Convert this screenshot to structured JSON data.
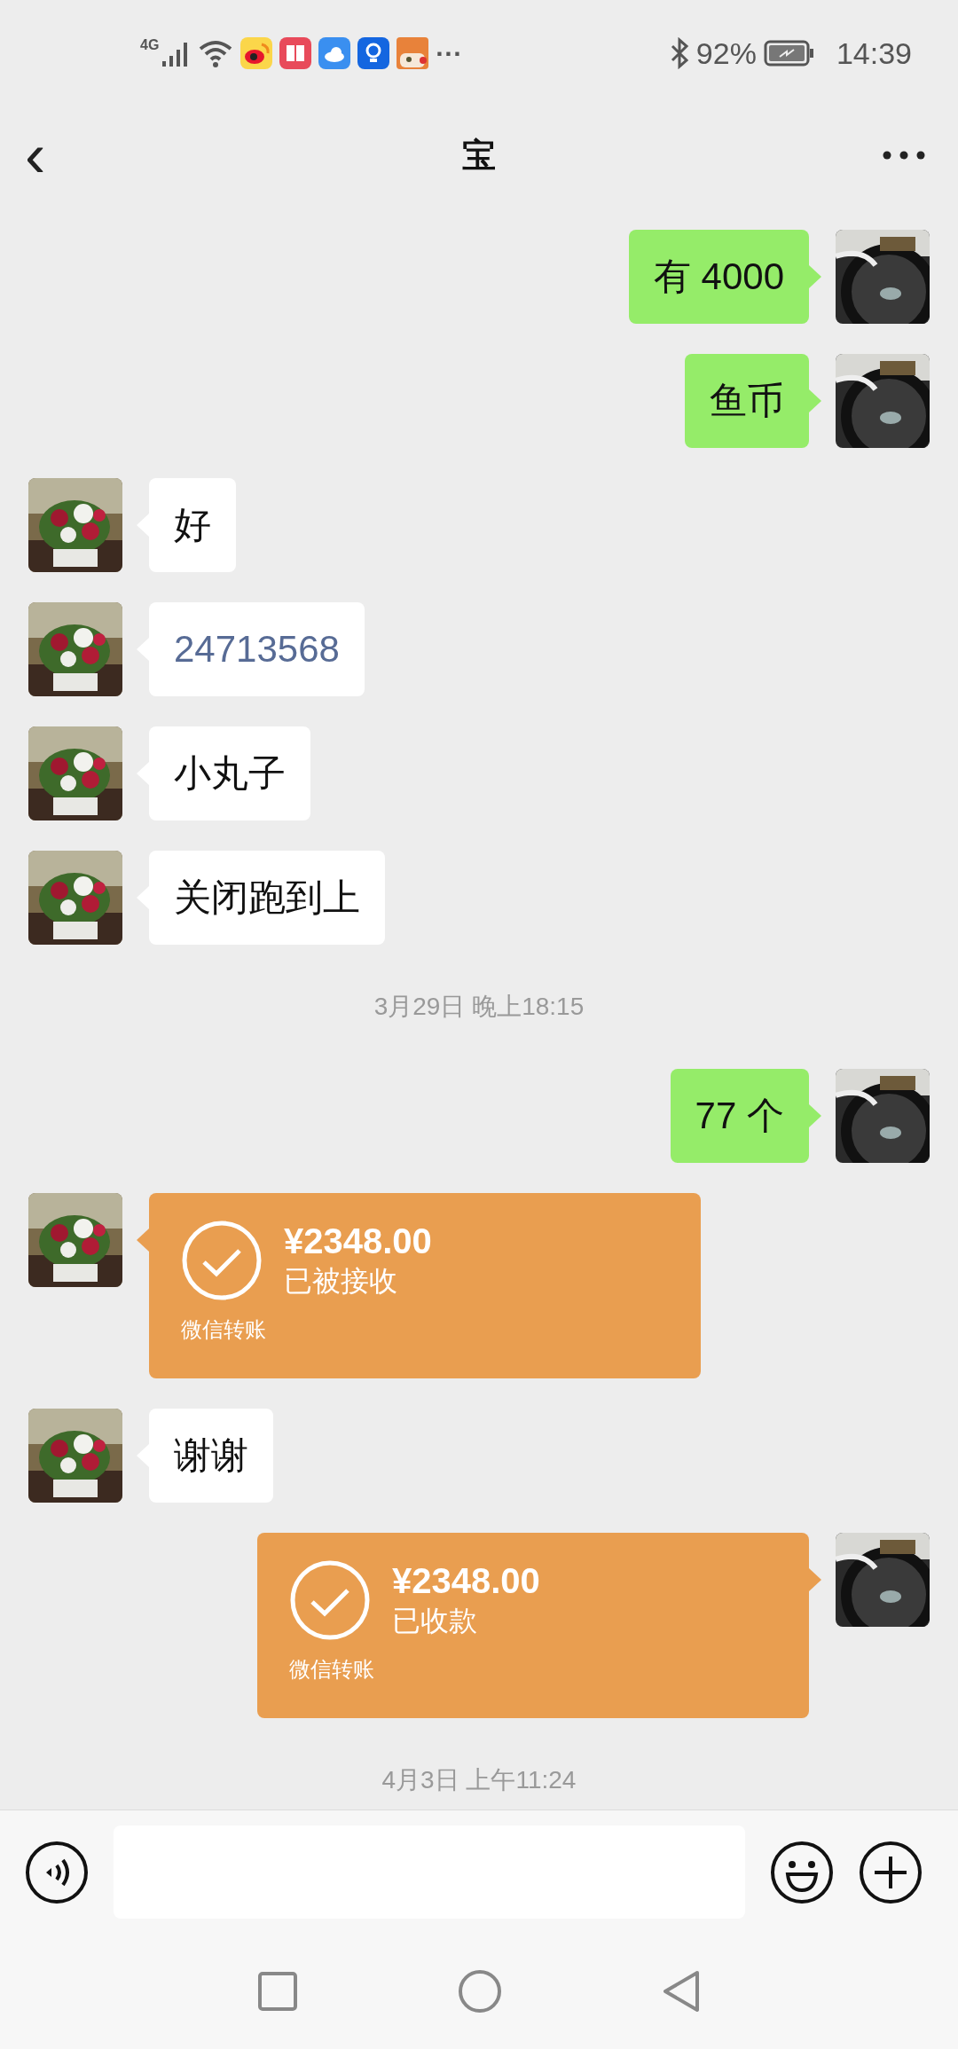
{
  "status_bar": {
    "network": "4G",
    "more": "···",
    "battery": "92%",
    "time": "14:39"
  },
  "header": {
    "back": "‹",
    "title": "宝"
  },
  "messages": [
    {
      "kind": "text",
      "outgoing": true,
      "text": "有 4000"
    },
    {
      "kind": "text",
      "outgoing": true,
      "text": "鱼币"
    },
    {
      "kind": "text",
      "outgoing": false,
      "text": "好"
    },
    {
      "kind": "number",
      "outgoing": false,
      "text": "24713568"
    },
    {
      "kind": "text",
      "outgoing": false,
      "text": "小丸子"
    },
    {
      "kind": "text",
      "outgoing": false,
      "text": "关闭跑到上"
    },
    {
      "kind": "time",
      "text": "3月29日 晚上18:15"
    },
    {
      "kind": "text",
      "outgoing": true,
      "text": "77 个"
    },
    {
      "kind": "transfer",
      "outgoing": false,
      "amount": "¥2348.00",
      "status": "已被接收",
      "label": "微信转账"
    },
    {
      "kind": "text",
      "outgoing": false,
      "text": "谢谢"
    },
    {
      "kind": "transfer",
      "outgoing": true,
      "amount": "¥2348.00",
      "status": "已收款",
      "label": "微信转账"
    },
    {
      "kind": "time",
      "text": "4月3日 上午11:24"
    }
  ]
}
